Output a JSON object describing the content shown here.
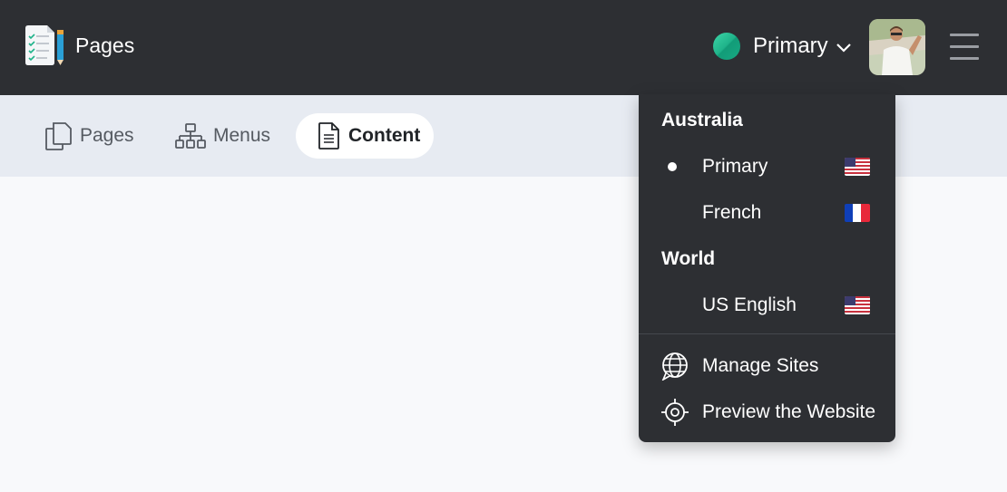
{
  "header": {
    "app_title": "Pages",
    "current_site": "Primary"
  },
  "tabs": [
    {
      "label": "Pages",
      "icon": "pages-icon",
      "active": false
    },
    {
      "label": "Menus",
      "icon": "sitemap-icon",
      "active": false
    },
    {
      "label": "Content",
      "icon": "document-icon",
      "active": true
    }
  ],
  "site_menu": {
    "groups": [
      {
        "name": "Australia",
        "sites": [
          {
            "label": "Primary",
            "flag": "us-flag",
            "selected": true
          },
          {
            "label": "French",
            "flag": "fr-flag",
            "selected": false
          }
        ]
      },
      {
        "name": "World",
        "sites": [
          {
            "label": "US English",
            "flag": "us-flag",
            "selected": false
          }
        ]
      }
    ],
    "actions": [
      {
        "label": "Manage Sites",
        "icon": "globe-icon"
      },
      {
        "label": "Preview the Website",
        "icon": "crosshair-icon"
      }
    ]
  },
  "colors": {
    "topbar": "#2d2f33",
    "subbar": "#e7ebf2",
    "site_dot": "#1fb38a",
    "background": "#f8f9fb"
  }
}
